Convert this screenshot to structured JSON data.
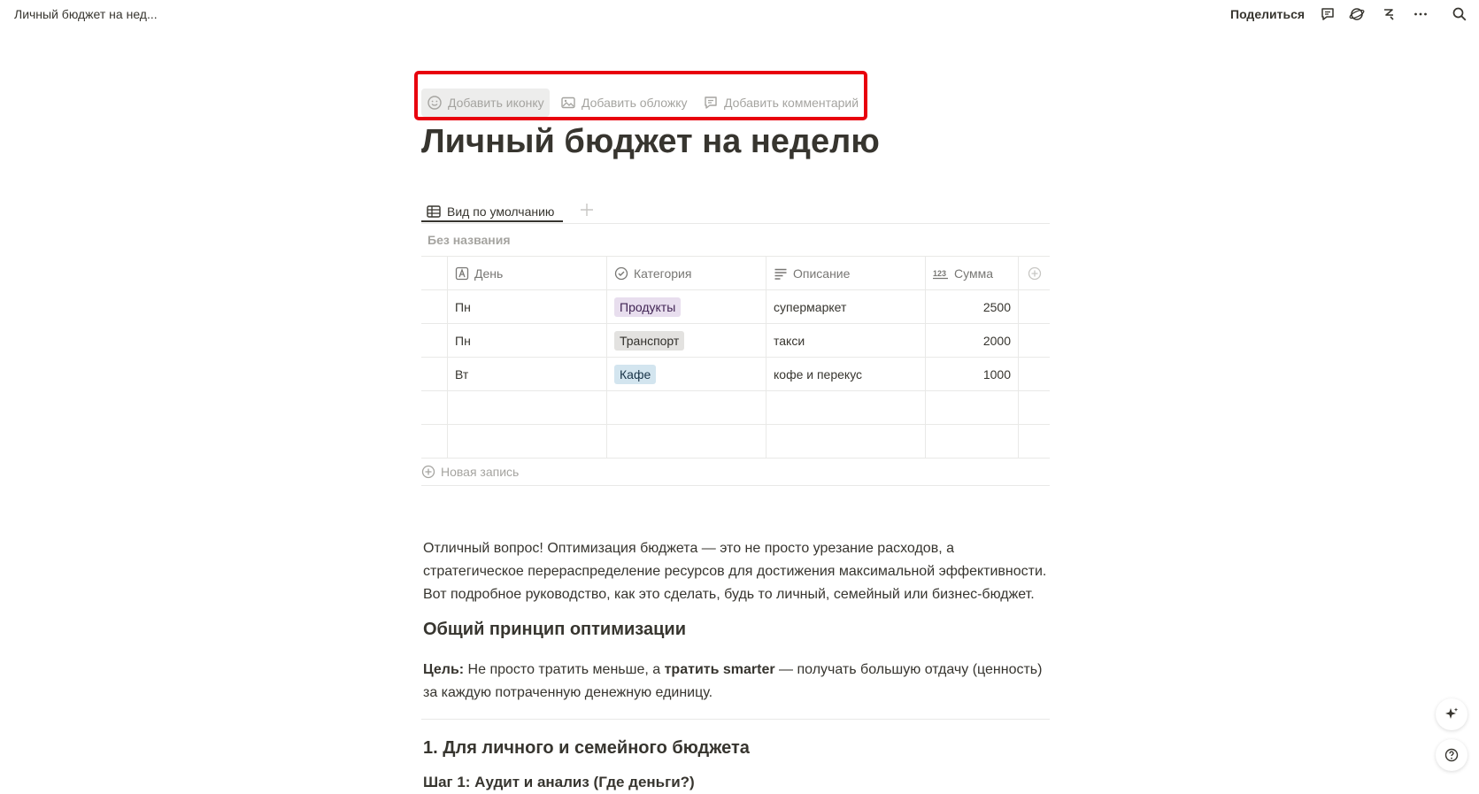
{
  "topbar": {
    "title": "Личный бюджет на нед...",
    "share_label": "Поделиться",
    "icons": [
      "comment-icon",
      "updates-icon",
      "ai-icon",
      "more-icon",
      "search-icon"
    ]
  },
  "page_actions": {
    "add_icon": "Добавить иконку",
    "add_cover": "Добавить обложку",
    "add_comment": "Добавить комментарий"
  },
  "title": "Личный бюджет на неделю",
  "view": {
    "tab_label": "Вид по умолчанию",
    "db_name": "Без названия",
    "new_row": "Новая запись"
  },
  "table": {
    "columns": [
      "День",
      "Категория",
      "Описание",
      "Сумма"
    ],
    "rows": [
      {
        "day": "Пн",
        "category": "Продукты",
        "category_bg": "#e8deee",
        "category_color": "#412454",
        "description": "супермаркет",
        "amount": "2500"
      },
      {
        "day": "Пн",
        "category": "Транспорт",
        "category_bg": "#e3e2e0",
        "category_color": "#32302c",
        "description": "такси",
        "amount": "2000"
      },
      {
        "day": "Вт",
        "category": "Кафе",
        "category_bg": "#d3e5ef",
        "category_color": "#183347",
        "description": "кофе и перекус",
        "amount": "1000"
      }
    ]
  },
  "article": {
    "intro": "Отличный вопрос! Оптимизация бюджета — это не просто урезание расходов, а стратегическое перераспределение ресурсов для достижения максимальной эффективности. Вот подробное руководство, как это сделать, будь то личный, семейный или бизнес-бюджет.",
    "h_principle": "Общий принцип оптимизации",
    "goal_label": "Цель:",
    "goal_text_1": " Не просто тратить меньше, а ",
    "goal_bold": "тратить smarter",
    "goal_text_2": " — получать большую отдачу (ценность) за каждую потраченную денежную единицу.",
    "h_section1": "1. Для личного и семейного бюджета",
    "h_step1": "Шаг 1: Аудит и анализ (Где деньги?)"
  },
  "colors": {
    "highlight_border": "#e8000d",
    "text": "#37352f",
    "muted": "#a5a4a0"
  }
}
